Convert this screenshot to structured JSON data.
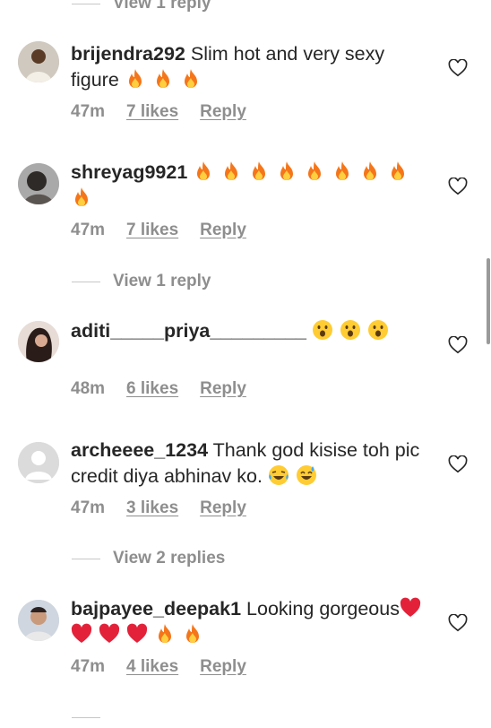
{
  "top_view_reply": "View 1 reply",
  "comments": [
    {
      "username": "brijendra292",
      "text": "Slim hot and very sexy figure",
      "time": "47m",
      "likes": "7 likes",
      "reply": "Reply",
      "avatar": "man-in-white-shirt-avatar",
      "trailing_emojis": [
        "fire",
        "fire",
        "fire"
      ]
    },
    {
      "username": "shreyag9921",
      "text": "",
      "time": "47m",
      "likes": "7 likes",
      "reply": "Reply",
      "avatar": "woman-dark-hair-avatar",
      "trailing_emojis": [
        "fire",
        "fire",
        "fire",
        "fire",
        "fire",
        "fire",
        "fire",
        "fire",
        "fire"
      ]
    },
    {
      "username": "aditi_____priya_________",
      "text": "",
      "time": "48m",
      "likes": "6 likes",
      "reply": "Reply",
      "avatar": "woman-long-hair-avatar",
      "trailing_emojis": [
        "surprised-face",
        "surprised-face",
        "surprised-face"
      ]
    },
    {
      "username": "archeeee_1234",
      "text": "Thank god kisise toh pic credit diya abhinav ko.",
      "time": "47m",
      "likes": "3 likes",
      "reply": "Reply",
      "avatar": "default-avatar",
      "trailing_emojis": [
        "tears-of-joy-face",
        "sweat-smile-face"
      ]
    },
    {
      "username": "bajpayee_deepak1",
      "text": "Looking gorgeous",
      "time": "47m",
      "likes": "4 likes",
      "reply": "Reply",
      "avatar": "man-portrait-avatar",
      "trailing_emojis": [
        "red-heart",
        "red-heart",
        "red-heart",
        "red-heart",
        "fire",
        "fire"
      ]
    }
  ],
  "view_replies": [
    "View 1 reply",
    "View 2 replies"
  ],
  "colors": {
    "text": "#262626",
    "secondary": "#8e8e8e",
    "fire": "#f5761a",
    "heart": "#e3223a"
  }
}
